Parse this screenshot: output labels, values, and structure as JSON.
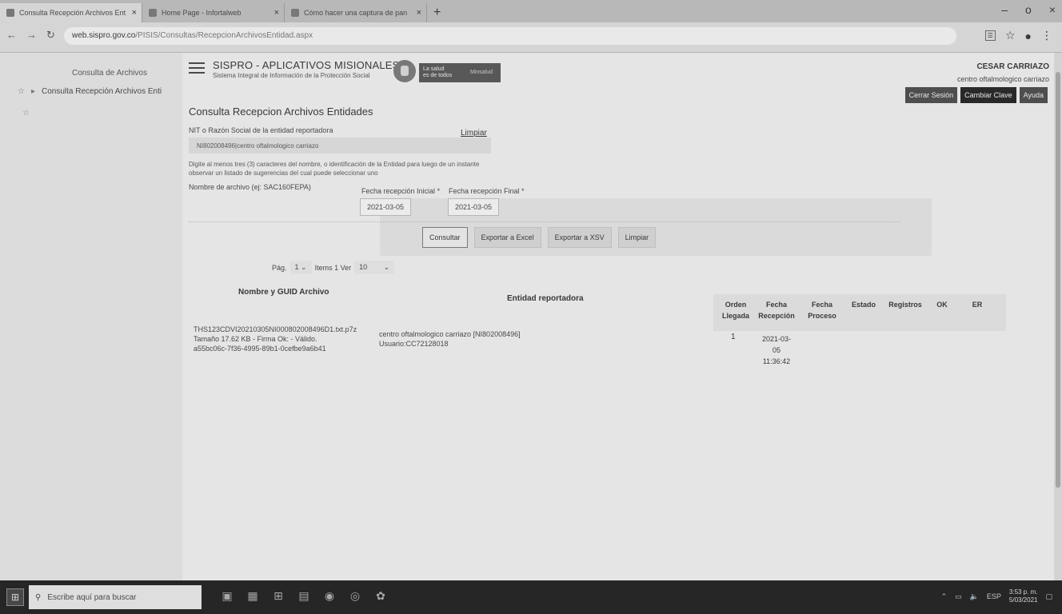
{
  "browser": {
    "tabs": [
      {
        "title": "Consulta Recepción Archivos Ent",
        "close": "×"
      },
      {
        "title": "Home Page - Infortalweb",
        "close": "×"
      },
      {
        "title": "Cómo hacer una captura de pan",
        "close": "×"
      }
    ],
    "new_tab": "+",
    "url_host": "web.sispro.gov.co",
    "url_path": "/PISIS/Consultas/RecepcionArchivosEntidad.aspx",
    "window_controls": [
      "–",
      "o",
      "×"
    ]
  },
  "sidebar": {
    "title": "Consulta de Archivos",
    "item": "Consulta Recepción Archivos Enti"
  },
  "header": {
    "title": "SISPRO - APLICATIVOS MISIONALES",
    "subtitle": "Sistema Integral de Información de la Protección Social",
    "banner_line1": "La salud",
    "banner_line2": "es de todos",
    "banner_right": "Minsalud",
    "user_name": "CESAR CARRIAZO",
    "user_entity": "centro oftalmologico carriazo",
    "buttons": {
      "cerrar": "Cerrar Sesión",
      "cambiar": "Cambiar Clave",
      "ayuda": "Ayuda"
    }
  },
  "form": {
    "page_title": "Consulta Recepcion Archivos Entidades",
    "entity_label": "NIT o Razón Social de la entidad reportadora",
    "limpiar_link": "Limpiar",
    "entity_value": "NI802008496|centro oftalmologico carriazo",
    "help_text": "Digite al menos tres (3) caracteres del nombre, o identificación de la Entidad para luego de un instante observar un listado de sugerencias del cual puede seleccionar uno",
    "archivo_label": "Nombre de archivo (ej: SAC160FEPA)",
    "fecha_inicial_label": "Fecha recepción Inicial *",
    "fecha_final_label": "Fecha recepción Final *",
    "fecha_inicial": "2021-03-05",
    "fecha_final": "2021-03-05"
  },
  "actions": {
    "consultar": "Consultar",
    "excel": "Exportar a Excel",
    "xsv": "Exportar a XSV",
    "limpiar": "Limpiar"
  },
  "pager": {
    "pag_label": "Pág.",
    "page": "1",
    "items_label": "Items 1 Ver",
    "per_page": "10"
  },
  "table": {
    "headers": {
      "nombre": "Nombre y GUID Archivo",
      "entidad": "Entidad reportadora",
      "orden": "Orden Llegada",
      "fecha_rec": "Fecha Recepción",
      "fecha_proc": "Fecha Proceso",
      "estado": "Estado",
      "registros": "Registros",
      "ok": "OK",
      "er": "ER"
    },
    "rows": [
      {
        "nombre_1": "THS123CDVI20210305NI000802008496D1.txt.p7z",
        "nombre_2": "Tamaño 17.62 KB - Firma Ok: - Válido.",
        "nombre_3": "a55bc06c-7f36-4995-89b1-0cefbe9a6b41",
        "entidad_1": "centro oftalmologico carriazo [NI802008496]",
        "entidad_2": "Usuario:CC72128018",
        "orden": "1",
        "fecha_1": "2021-03-",
        "fecha_2": "05",
        "fecha_3": "11:36:42"
      }
    ]
  },
  "taskbar": {
    "search_placeholder": "Escribe aquí para buscar",
    "lang": "ESP",
    "time": "3:53 p. m.",
    "date": "5/03/2021"
  }
}
